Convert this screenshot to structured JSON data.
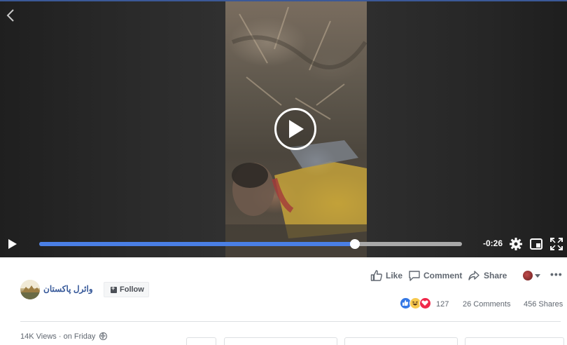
{
  "player": {
    "time_remaining": "-0:26",
    "progress_fraction": 0.747,
    "icons": [
      "back-chevron-icon",
      "play-icon",
      "settings-gear-icon",
      "picture-in-picture-icon",
      "fullscreen-icon"
    ]
  },
  "post": {
    "page_name": "وائرل پاکستان",
    "follow_label": "Follow",
    "views": "14K Views",
    "separator": "·",
    "posted": "on Friday"
  },
  "actions": {
    "like": "Like",
    "comment": "Comment",
    "share": "Share",
    "more": "•••"
  },
  "stats": {
    "reactions_count": "127",
    "comments": "26 Comments",
    "shares": "456 Shares",
    "reaction_types": [
      "like",
      "haha",
      "love"
    ]
  },
  "colors": {
    "accent": "#4a7fe5",
    "link": "#365899",
    "like_blue": "#3578e5",
    "haha_yellow": "#f7c94e",
    "love_red": "#f0284a"
  }
}
